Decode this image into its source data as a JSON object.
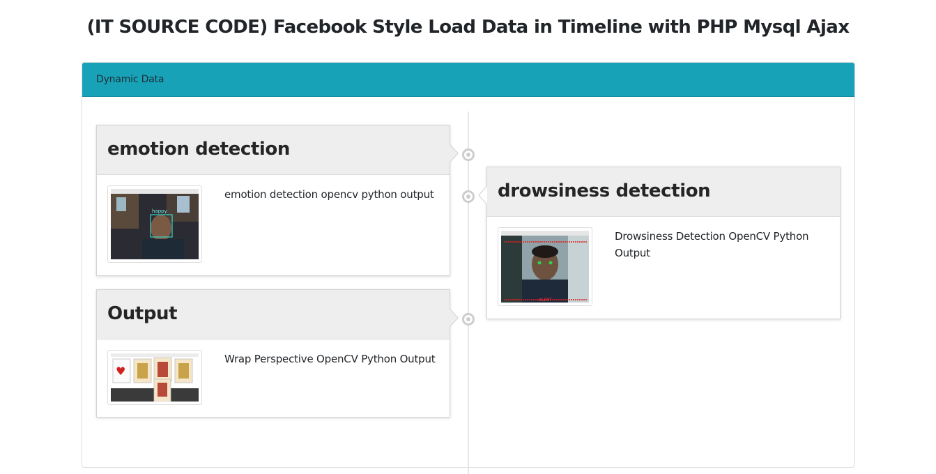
{
  "page": {
    "title": "(IT SOURCE CODE) Facebook Style Load Data in Timeline with PHP Mysql Ajax"
  },
  "panel": {
    "heading": "Dynamic Data"
  },
  "timeline": {
    "posts": [
      {
        "side": "left",
        "title": "emotion detection",
        "text": "emotion detection opencv python output",
        "thumb_caption": "happy"
      },
      {
        "side": "right",
        "title": "drowsiness detection",
        "text": "Drowsiness Detection OpenCV Python Output",
        "thumb_caption": "ALERT"
      },
      {
        "side": "left",
        "title": "Output",
        "text": "Wrap Perspective OpenCV Python Output"
      }
    ]
  },
  "colors": {
    "heading_bg": "#17a2b8",
    "card_head_bg": "#eeeeee",
    "badge": "#cdcdcd"
  }
}
